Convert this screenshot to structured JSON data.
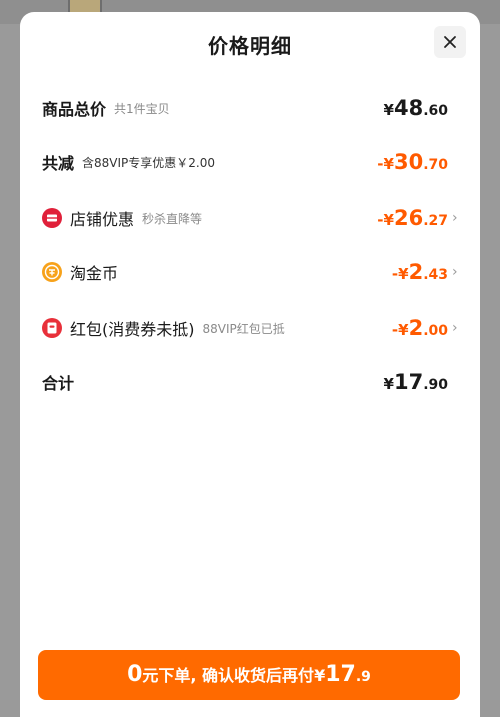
{
  "sheet": {
    "title": "价格明细",
    "close_label": "×"
  },
  "rows": {
    "total": {
      "label": "商品总价",
      "sub": "共1件宝贝",
      "currency": "¥",
      "int": "48",
      "dec": ".60"
    },
    "reduce": {
      "label": "共减",
      "sub": "含88VIP专享优惠￥2.00",
      "currency": "-¥",
      "int": "30",
      "dec": ".70"
    },
    "shop": {
      "label": "店铺优惠",
      "sub": "秒杀直降等",
      "currency": "-¥",
      "int": "26",
      "dec": ".27"
    },
    "coin": {
      "label": "淘金币",
      "sub": "",
      "currency": "-¥",
      "int": "2",
      "dec": ".43"
    },
    "redpack": {
      "label": "红包(消费券未抵)",
      "sub": "88VIP红包已抵",
      "currency": "-¥",
      "int": "2",
      "dec": ".00"
    },
    "sum": {
      "label": "合计",
      "currency": "¥",
      "int": "17",
      "dec": ".90"
    }
  },
  "confirm": {
    "zero": "0",
    "text": "元下单, 确认收货后再付",
    "currency": "¥",
    "int": "17",
    "dec": ".9"
  },
  "colors": {
    "accent": "#ff6a00",
    "discount": "#ff5a00",
    "shop_icon": "#e0203a",
    "coin_icon": "#f7a21b",
    "redpack_icon": "#e8303a"
  },
  "icons": {
    "shop": "shop-coupon-icon",
    "coin": "taojinbi-coin-icon",
    "redpack": "red-envelope-icon",
    "chevron": "chevron-right-icon",
    "close": "close-icon"
  }
}
